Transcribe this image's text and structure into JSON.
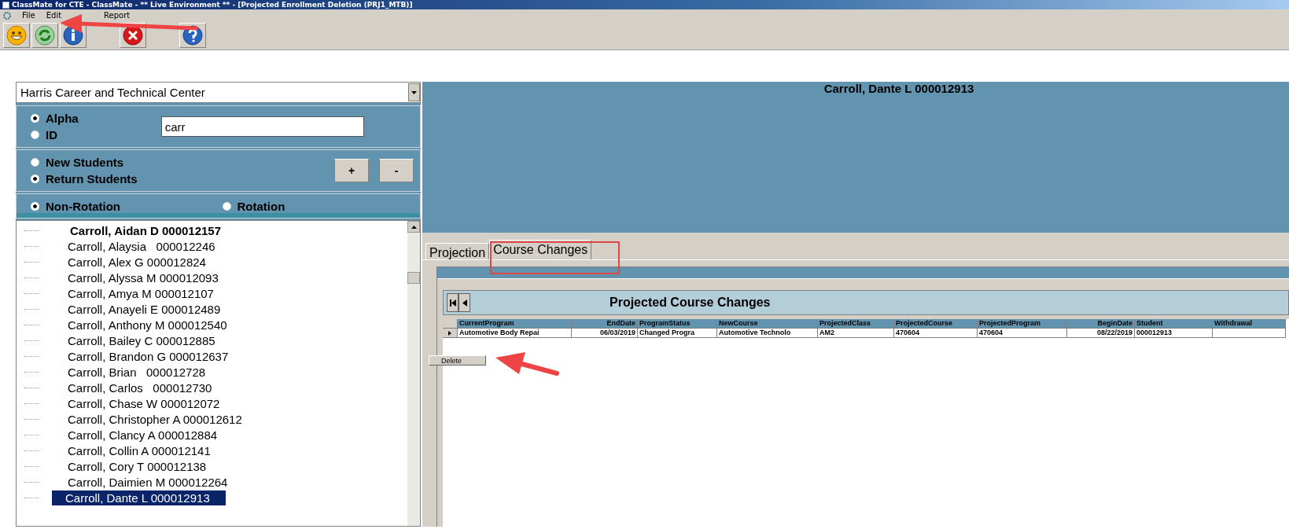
{
  "window": {
    "title": "ClassMate for CTE - ClassMate - ** Live Environment ** - [Projected Enrollment Deletion (PRJ1_MTB)]"
  },
  "menu": [
    "File",
    "Edit",
    "Report"
  ],
  "toolbar": [
    {
      "kind": "smiley"
    },
    {
      "kind": "refresh"
    },
    {
      "kind": "info"
    },
    {
      "kind": "close"
    },
    {
      "kind": "help"
    }
  ],
  "school_select": {
    "value": "Harris Career and Technical Center"
  },
  "search_mode": [
    {
      "label": "Alpha",
      "selected": true
    },
    {
      "label": "ID",
      "selected": false
    }
  ],
  "search_field": {
    "value": "carr"
  },
  "student_type": [
    {
      "label": "New Students",
      "selected": false
    },
    {
      "label": "Return Students",
      "selected": true
    }
  ],
  "step_buttons": [
    "+",
    "-"
  ],
  "rotation": [
    {
      "label": "Non-Rotation",
      "selected": true
    },
    {
      "label": "Rotation",
      "selected": false
    }
  ],
  "students": [
    {
      "label": "Carroll, Aidan D 000012157",
      "bold": true,
      "selected": false
    },
    {
      "label": "Carroll, Alaysia   000012246",
      "bold": false,
      "selected": false
    },
    {
      "label": "Carroll, Alex G 000012824",
      "bold": false,
      "selected": false
    },
    {
      "label": "Carroll, Alyssa M 000012093",
      "bold": false,
      "selected": false
    },
    {
      "label": "Carroll, Amya M 000012107",
      "bold": false,
      "selected": false
    },
    {
      "label": "Carroll, Anayeli E 000012489",
      "bold": false,
      "selected": false
    },
    {
      "label": "Carroll, Anthony M 000012540",
      "bold": false,
      "selected": false
    },
    {
      "label": "Carroll, Bailey C 000012885",
      "bold": false,
      "selected": false
    },
    {
      "label": "Carroll, Brandon G 000012637",
      "bold": false,
      "selected": false
    },
    {
      "label": "Carroll, Brian   000012728",
      "bold": false,
      "selected": false
    },
    {
      "label": "Carroll, Carlos   000012730",
      "bold": false,
      "selected": false
    },
    {
      "label": "Carroll, Chase W 000012072",
      "bold": false,
      "selected": false
    },
    {
      "label": "Carroll, Christopher A 000012612",
      "bold": false,
      "selected": false
    },
    {
      "label": "Carroll, Clancy A 000012884",
      "bold": false,
      "selected": false
    },
    {
      "label": "Carroll, Collin A 000012141",
      "bold": false,
      "selected": false
    },
    {
      "label": "Carroll, Cory T 000012138",
      "bold": false,
      "selected": false
    },
    {
      "label": "Carroll, Daimien M 000012264",
      "bold": false,
      "selected": false
    },
    {
      "label": "Carroll, Dante L 000012913",
      "bold": false,
      "selected": true
    }
  ],
  "student_header": "Carroll, Dante L 000012913",
  "tabs": [
    {
      "label": "Projection",
      "selected": false
    },
    {
      "label": "Course Changes",
      "selected": true
    }
  ],
  "grid": {
    "title": "Projected Course Changes",
    "columns": [
      "CurrentProgram",
      "EndDate",
      "ProgramStatus",
      "NewCourse",
      "ProjectedClass",
      "ProjectedCourse",
      "ProjectedProgram",
      "BeginDate",
      "Student",
      "Withdrawal"
    ],
    "rows": [
      [
        "Automotive Body Repai",
        "06/03/2019",
        "Changed Progra",
        "Automotive Technolo",
        "AM2",
        "470604",
        "470604",
        "08/22/2019",
        "000012913",
        ""
      ]
    ]
  },
  "context_menu": [
    "Delete"
  ]
}
